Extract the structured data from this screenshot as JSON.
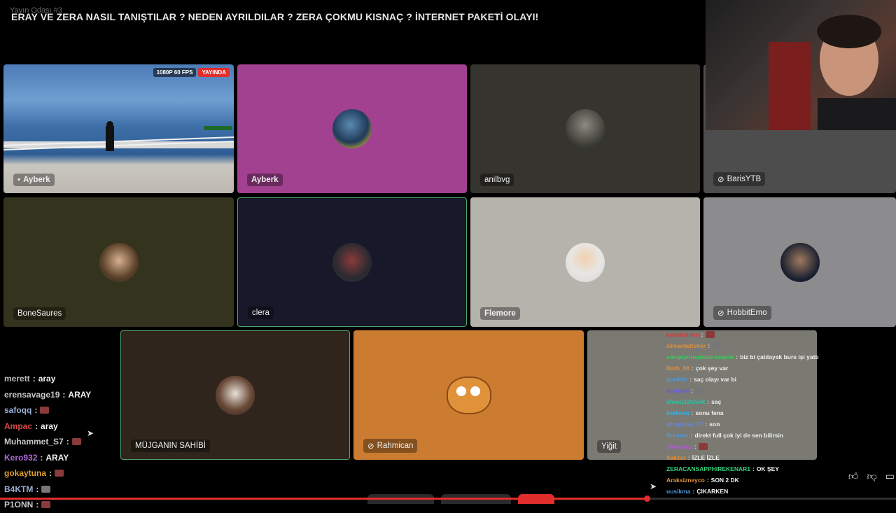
{
  "window": {
    "room_label": "Yayın Odası #3",
    "title": "ERAY VE ZERA NASIL TANIŞTILAR ? NEDEN AYRILDILAR ? ZERA ÇOKMU KISNAÇ ? İNTERNET PAKETİ OLAYI!"
  },
  "stream_tile": {
    "quality_badge": "1080P 60 FPS",
    "live_badge": "YAYINDA",
    "name": "Ayberk"
  },
  "participants": [
    {
      "name": "Ayberk",
      "color": "#a2418f"
    },
    {
      "name": "anilbvg",
      "color": "#35342f"
    },
    {
      "name": "BarisYTB",
      "color": "#4d4d4d"
    },
    {
      "name": "BoneSaures",
      "color": "#34341e"
    },
    {
      "name": "clera",
      "color": "#17192a"
    },
    {
      "name": "Flemore",
      "color": "#b6b3ad"
    },
    {
      "name": "HobbitEmo",
      "color": "#8c8c8e"
    },
    {
      "name": "MÜJGANIN SAHİBİ",
      "color": "#2f251c"
    },
    {
      "name": "Rahmican",
      "color": "#cc7c30"
    },
    {
      "name": "Yiğit",
      "color": "#7a7972"
    }
  ],
  "chat_left": [
    {
      "user": "merett",
      "message": "aray",
      "color": "#bbbbbb"
    },
    {
      "user": "erensavage19",
      "message": "ARAY",
      "color": "#c8c8c8"
    },
    {
      "user": "safoqq",
      "message": "",
      "color": "#9ab0d8",
      "emote": true
    },
    {
      "user": "Ampac",
      "message": "aray",
      "color": "#d64848"
    },
    {
      "user": "Muhammet_S7",
      "message": "",
      "color": "#c8c8c8",
      "emote": true
    },
    {
      "user": "Kero932",
      "message": "ARAY",
      "color": "#b06ad8"
    },
    {
      "user": "gokaytuna",
      "message": "",
      "color": "#e0a030",
      "emote": true
    },
    {
      "user": "B4KTM",
      "message": "",
      "color": "#9ab0d8",
      "emote": true
    },
    {
      "user": "P1ONN",
      "message": "",
      "color": "#c8c8c8",
      "emote": true
    }
  ],
  "chat_right": [
    {
      "user": "kabakumen",
      "message": "",
      "color": "#d63a3a",
      "emote": true
    },
    {
      "user": "zireaelwitcher",
      "message": "",
      "color": "#e0903a",
      "emote": true
    },
    {
      "user": "sampiyonsunbursaspor",
      "message": "biz bi çatılayak burs işi yattı",
      "color": "#34d05a"
    },
    {
      "user": "Nath_06",
      "message": "çok şey var",
      "color": "#e0903a"
    },
    {
      "user": "burAlkr",
      "message": "saç olayı var bi",
      "color": "#4a9ae0"
    },
    {
      "user": "tunusee",
      "message": "",
      "color": "#6a5ae0",
      "emote": true
    },
    {
      "user": "afewq32t3w4t",
      "message": "saç",
      "color": "#34c0a0"
    },
    {
      "user": "berkkan",
      "message": "sonu fena",
      "color": "#3ab0e0"
    },
    {
      "user": "drogbaaa_37",
      "message": "son",
      "color": "#6a88d8"
    },
    {
      "user": "Brestan",
      "message": "direkt full çok iyi de sen bilirsin",
      "color": "#4a9ae0"
    },
    {
      "user": "okhastay",
      "message": "",
      "color": "#b05ad8",
      "emote": true
    },
    {
      "user": "Xakzzz",
      "message": "İZLE İZLE",
      "color": "#e0903a"
    },
    {
      "user": "ZERACANSAPPHIREKENAR1",
      "message": "OK ŞEY",
      "color": "#34d07a"
    },
    {
      "user": "Araksizneyco",
      "message": "SON 2 DK",
      "color": "#e0903a"
    },
    {
      "user": "uusikma",
      "message": "ÇIKARKEN",
      "color": "#4a9ae0"
    }
  ],
  "player": {
    "progress_fraction": 0.722,
    "accent": "#e22d2d"
  },
  "icons": [
    "like-icon",
    "dislike-icon",
    "share-icon",
    "mic-icon",
    "camera-icon",
    "cursor-icon"
  ]
}
